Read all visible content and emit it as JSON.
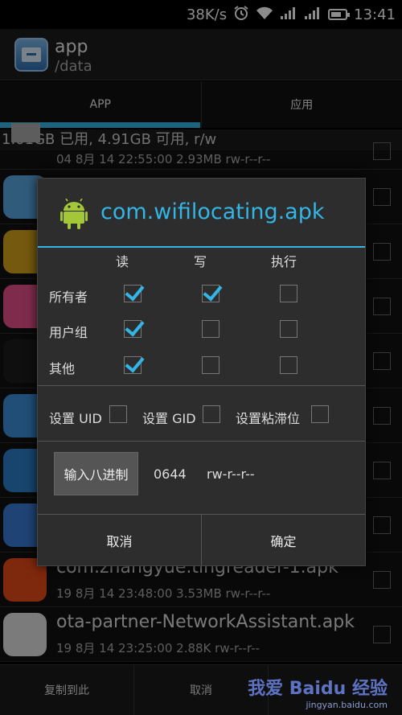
{
  "status_bar": {
    "network_speed": "38K/s",
    "time": "13:41",
    "battery_level": 0.75,
    "icons": [
      "alarm-icon",
      "wifi-icon",
      "signal-icon",
      "signal-icon",
      "battery-icon"
    ]
  },
  "app_header": {
    "title": "app",
    "path": "/data"
  },
  "tabs": [
    {
      "label": "APP",
      "active": true
    },
    {
      "label": "应用",
      "active": false
    }
  ],
  "storage_info": "1.01GB 已用, 4.91GB 可用, r/w",
  "files": [
    {
      "name": "",
      "meta": "04 8月 14 22:55:00  2.93MB  rw-r--r--",
      "icon_color": "#888888"
    },
    {
      "name": "",
      "meta": "",
      "icon_color": "#5aa6e0"
    },
    {
      "name": "",
      "meta": "",
      "icon_color": "#d4a21c"
    },
    {
      "name": "",
      "meta": "",
      "icon_color": "#e8508a"
    },
    {
      "name": "",
      "meta": "",
      "icon_color": "#1d1d1d"
    },
    {
      "name": "",
      "meta": "",
      "icon_color": "#3b8fd8"
    },
    {
      "name": "",
      "meta": "",
      "icon_color": "#2d7fc9"
    },
    {
      "name": "",
      "meta": "",
      "icon_color": "#3a7bd5"
    },
    {
      "name": "com.zhangyue.tingreader-1.apk",
      "meta": "19 8月 14 23:48:00  3.53MB  rw-r--r--",
      "icon_color": "#e64a19"
    },
    {
      "name": "ota-partner-NetworkAssistant.apk",
      "meta": "19 8月 14 23:25:00  2.88K  rw-r--r--",
      "icon_color": "#e0e0e0"
    }
  ],
  "bottom_bar": {
    "copy_here": "复制到此",
    "cancel": "取消"
  },
  "dialog": {
    "title": "com.wifilocating.apk",
    "columns": {
      "read": "读",
      "write": "写",
      "execute": "执行"
    },
    "rows": [
      {
        "label": "所有者",
        "read": true,
        "write": true,
        "execute": false
      },
      {
        "label": "用户组",
        "read": true,
        "write": false,
        "execute": false
      },
      {
        "label": "其他",
        "read": true,
        "write": false,
        "execute": false
      }
    ],
    "flags": {
      "set_uid": "设置 UID",
      "set_gid": "设置 GID",
      "sticky": "设置粘滞位"
    },
    "octal_button": "输入八进制",
    "octal_value": "0644",
    "permission_string": "rw-r--r--",
    "cancel": "取消",
    "ok": "确定"
  },
  "watermark": {
    "main": "我爱 Baidu 经验",
    "sub": "jingyan.baidu.com"
  },
  "colors": {
    "accent": "#33b5e5",
    "background": "#000000",
    "dialog_bg": "#2d2d2d"
  }
}
